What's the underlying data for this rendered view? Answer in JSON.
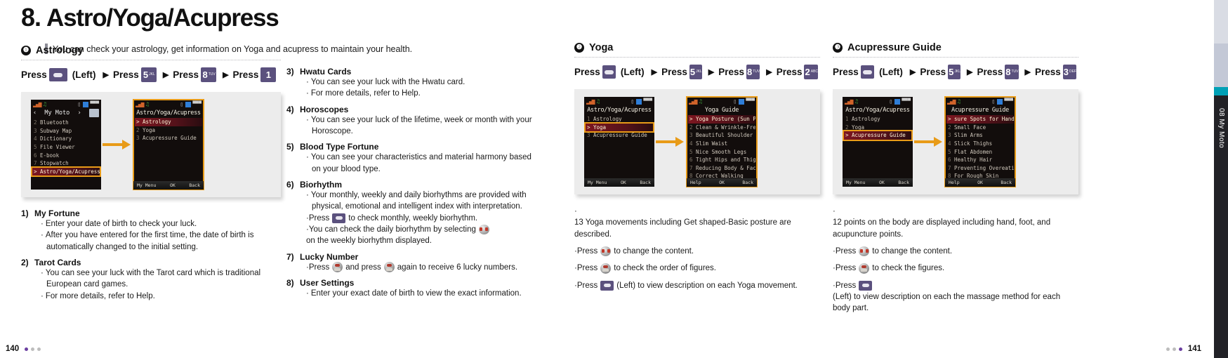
{
  "chapter": {
    "number": "8.",
    "title": "Astro/Yoga/Acupress",
    "lead": "You can check your astrology, get information on Yoga and acupress to maintain your health."
  },
  "sections": {
    "astrology": {
      "badge": "❶",
      "title": "Astrology",
      "press_sequence": {
        "press_label": "Press",
        "left_label": "(Left)",
        "arrow": "▶",
        "keys": [
          {
            "type": "softkey",
            "label": ""
          },
          {
            "type": "numkey",
            "digit": "5",
            "sub": "JKL"
          },
          {
            "type": "numkey",
            "digit": "8",
            "sub": "TUV"
          },
          {
            "type": "numkey",
            "digit": "1",
            "sub": ""
          }
        ]
      },
      "phone_left": {
        "title": "My Moto",
        "prev": "‹",
        "next": "›",
        "items": [
          {
            "idx": "2",
            "label": "Bluetooth"
          },
          {
            "idx": "3",
            "label": "Subway Map"
          },
          {
            "idx": "4",
            "label": "Dictionary"
          },
          {
            "idx": "5",
            "label": "File Viewer"
          },
          {
            "idx": "6",
            "label": "E-book"
          },
          {
            "idx": "7",
            "label": "Stopwatch"
          },
          {
            "idx": ">",
            "label": "Astro/Yoga/Acupress",
            "selected": true
          }
        ],
        "softkeys": []
      },
      "phone_right": {
        "title": "Astro/Yoga/Acupress",
        "items": [
          {
            "idx": ">",
            "label": "Astrology",
            "selected": true
          },
          {
            "idx": "2",
            "label": "Yoga"
          },
          {
            "idx": "3",
            "label": "Acupressure Guide"
          }
        ],
        "softkeys": [
          "My Menu",
          "OK",
          "Back"
        ]
      },
      "list": [
        {
          "n": "1)",
          "title": "My Fortune",
          "bullets": [
            "Enter your date of birth to check your luck.",
            "After you have entered for the first time, the date of birth is automatically changed to the initial setting."
          ]
        },
        {
          "n": "2)",
          "title": "Tarot Cards",
          "bullets": [
            "You can see your luck with the Tarot card which is traditional European card games.",
            "For more details, refer to Help."
          ]
        }
      ],
      "list2": [
        {
          "n": "3)",
          "title": "Hwatu Cards",
          "bullets": [
            "You can see your luck with the Hwatu card.",
            "For more details, refer to Help."
          ]
        },
        {
          "n": "4)",
          "title": "Horoscopes",
          "bullets": [
            "You can see your luck of the lifetime, week or month with your Horoscope."
          ]
        },
        {
          "n": "5)",
          "title": "Blood Type Fortune",
          "bullets": [
            "You can see your characteristics and material harmony based on your blood type."
          ]
        },
        {
          "n": "6)",
          "title": "Biorhythm",
          "bullets": [
            "Your monthly, weekly and daily biorhythms are provided with physical, emotional and intelligent index with interpretation."
          ],
          "key_bullets": [
            {
              "pre": "Press",
              "key": "softkey",
              "post": "to check monthly, weekly biorhythm."
            },
            {
              "pre": "You can check the daily biorhythm by selecting",
              "key": "navkey",
              "post": "on the weekly biorhythm displayed."
            }
          ]
        },
        {
          "n": "7)",
          "title": "Lucky Number",
          "key_bullets": [
            {
              "pre": "Press",
              "key": "okkey",
              "mid": "and press",
              "key2": "okkey",
              "post": "again to receive 6 lucky numbers."
            }
          ]
        },
        {
          "n": "8)",
          "title": "User Settings",
          "bullets": [
            "Enter your exact date of birth to view the exact information."
          ]
        }
      ]
    },
    "yoga": {
      "badge": "❷",
      "title": "Yoga",
      "press_sequence": {
        "press_label": "Press",
        "left_label": "(Left)",
        "arrow": "▶",
        "keys": [
          {
            "type": "softkey",
            "label": ""
          },
          {
            "type": "numkey",
            "digit": "5",
            "sub": "JKL"
          },
          {
            "type": "numkey",
            "digit": "8",
            "sub": "TUV"
          },
          {
            "type": "numkey",
            "digit": "2",
            "sub": "ABC"
          }
        ]
      },
      "phone_left": {
        "title": "Astro/Yoga/Acupress",
        "items": [
          {
            "idx": "1",
            "label": "Astrology"
          },
          {
            "idx": ">",
            "label": "Yoga",
            "selected": true,
            "boxed": true
          },
          {
            "idx": "3",
            "label": "Acupressure Guide"
          }
        ],
        "softkeys": [
          "My Menu",
          "OK",
          "Back"
        ]
      },
      "phone_right": {
        "title": "Yoga Guide",
        "items": [
          {
            "idx": ">",
            "label": "Yoga Posture (Sun Postu",
            "selected": true
          },
          {
            "idx": "2",
            "label": "Clean & Wrinkle-Free Fac"
          },
          {
            "idx": "3",
            "label": "Beautiful Shoulder Line"
          },
          {
            "idx": "4",
            "label": "Slim Waist"
          },
          {
            "idx": "5",
            "label": "Nice Smooth Legs"
          },
          {
            "idx": "6",
            "label": "Tight Hips and Thighs"
          },
          {
            "idx": "7",
            "label": "Reducing Body & Face Swe"
          },
          {
            "idx": "8",
            "label": "Correct Walking"
          }
        ],
        "softkeys": [
          "Help",
          "OK",
          "Back"
        ]
      },
      "bullets": [
        {
          "pre": "13 Yoga movements including Get shaped-Basic posture are described.",
          "key": null
        },
        {
          "pre": "Press",
          "key": "navkey",
          "post": "to change the content."
        },
        {
          "pre": "Press",
          "key": "okkey",
          "post": "to check the order of figures."
        },
        {
          "pre": "Press",
          "key": "softkey",
          "post": "(Left) to view description on each Yoga movement."
        }
      ]
    },
    "acupressure": {
      "badge": "❸",
      "title": "Acupressure Guide",
      "press_sequence": {
        "press_label": "Press",
        "left_label": "(Left)",
        "arrow": "▶",
        "keys": [
          {
            "type": "softkey",
            "label": ""
          },
          {
            "type": "numkey",
            "digit": "5",
            "sub": "JKL"
          },
          {
            "type": "numkey",
            "digit": "8",
            "sub": "TUV"
          },
          {
            "type": "numkey",
            "digit": "3",
            "sub": "DEF"
          }
        ]
      },
      "phone_left": {
        "title": "Astro/Yoga/Acupress",
        "items": [
          {
            "idx": "1",
            "label": "Astrology"
          },
          {
            "idx": "2",
            "label": "Yoga"
          },
          {
            "idx": ">",
            "label": "Acupressure Guide",
            "selected": true,
            "boxed": true
          }
        ],
        "softkeys": [
          "My Menu",
          "OK",
          "Back"
        ]
      },
      "phone_right": {
        "title": "Acupressure Guide",
        "items": [
          {
            "idx": ">",
            "label": "sure Spots for Hands & Fe",
            "selected": true
          },
          {
            "idx": "2",
            "label": "Small Face"
          },
          {
            "idx": "3",
            "label": "Slim Arms"
          },
          {
            "idx": "4",
            "label": "Slick Thighs"
          },
          {
            "idx": "5",
            "label": "Flat Abdomen"
          },
          {
            "idx": "6",
            "label": "Healthy Hair"
          },
          {
            "idx": "7",
            "label": "Preventing Overeating"
          },
          {
            "idx": "8",
            "label": "For Rough Skin"
          }
        ],
        "softkeys": [
          "Help",
          "OK",
          "Back"
        ]
      },
      "bullets": [
        {
          "pre": "12 points on the body are displayed including hand, foot, and acupuncture points.",
          "key": null
        },
        {
          "pre": "Press",
          "key": "navkey",
          "post": "to change the content."
        },
        {
          "pre": "Press",
          "key": "okkey",
          "post": "to check the figures."
        },
        {
          "pre": "Press",
          "key": "softkey",
          "post": "(Left) to view description on each the massage method for each body part."
        }
      ]
    }
  },
  "footer": {
    "page_left": "140",
    "page_right": "141"
  },
  "edge_tab": {
    "label": "08 My Moto"
  }
}
